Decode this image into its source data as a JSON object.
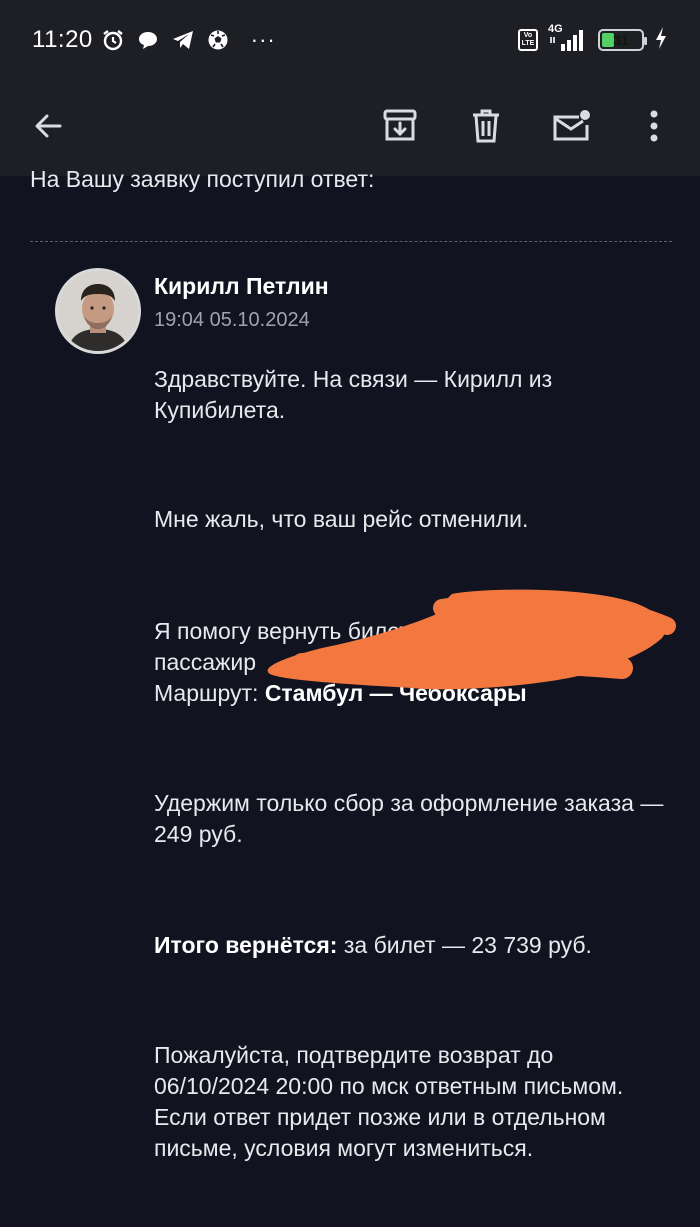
{
  "status_bar": {
    "time": "11:20",
    "network_type": "4G",
    "lte_badge": "Vo LTE",
    "battery_level": "31",
    "battery_fraction": 0.31,
    "more_indicator": "···",
    "icons": [
      "alarm-icon",
      "chat-bubble-icon",
      "telegram-icon",
      "soccer-ball-icon",
      "signal-icon",
      "charging-icon"
    ]
  },
  "toolbar": {
    "icons": [
      "back-arrow-icon",
      "archive-icon",
      "delete-icon",
      "mark-unread-icon",
      "more-vert-icon"
    ]
  },
  "email": {
    "intro_line": "На Вашу заявку поступил ответ:",
    "sender_name": "Кирилл Петлин",
    "sent_at": "19:04 05.10.2024",
    "paragraph_1": "Здравствуйте. На связи — Кирилл из Купибилета.",
    "paragraph_2": "Мне жаль, что ваш рейс отменили.",
    "paragraph_3_line_1": "Я помогу вернуть билет",
    "paragraph_3_line_2": "пассажир",
    "route_label": "Маршрут:",
    "route_value": "Стамбул — Чебоксары",
    "paragraph_4": "Удержим только сбор за оформление заказа — 249 руб.",
    "total_label": "Итого вернётся:",
    "total_value": "за билет — 23 739 руб.",
    "paragraph_6": "Пожалуйста, подтвердите возврат до 06/10/2024 20:00 по мск ответным письмом. Если ответ придет позже или в отдельном письме, условия могут измениться."
  },
  "colors": {
    "background": "#111420",
    "bar_background": "#1d1f24",
    "redaction": "#f2783f",
    "battery_green": "#51d163"
  }
}
